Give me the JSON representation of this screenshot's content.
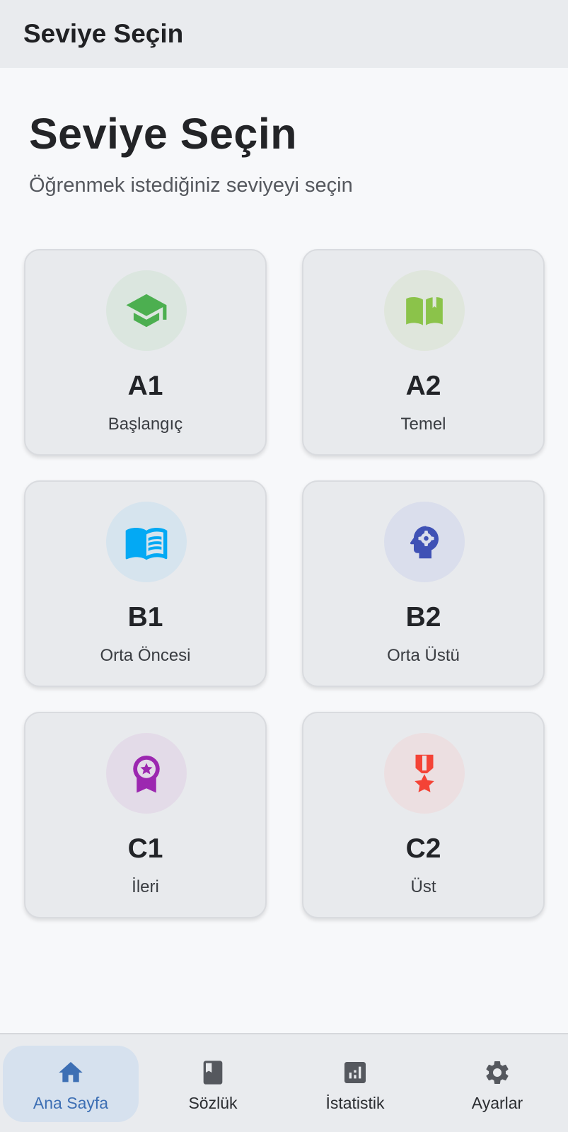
{
  "app_bar": {
    "title": "Seviye Seçin"
  },
  "main": {
    "title": "Seviye Seçin",
    "subtitle": "Öğrenmek istediğiniz seviyeyi seçin"
  },
  "levels": [
    {
      "code": "A1",
      "name": "Başlangıç",
      "icon": "graduation-cap-icon",
      "color": "#4caf50",
      "circle": "#dbe6df"
    },
    {
      "code": "A2",
      "name": "Temel",
      "icon": "open-book-icon",
      "color": "#8bc34a",
      "circle": "#dfe6dc"
    },
    {
      "code": "B1",
      "name": "Orta Öncesi",
      "icon": "reading-book-icon",
      "color": "#03a9f4",
      "circle": "#d6e4ee"
    },
    {
      "code": "B2",
      "name": "Orta Üstü",
      "icon": "psychology-head-icon",
      "color": "#3f51b5",
      "circle": "#dadeec"
    },
    {
      "code": "C1",
      "name": "İleri",
      "icon": "award-badge-icon",
      "color": "#9c27b0",
      "circle": "#e3dbe8"
    },
    {
      "code": "C2",
      "name": "Üst",
      "icon": "military-medal-icon",
      "color": "#f44336",
      "circle": "#ecdfe1"
    }
  ],
  "bottom_nav": {
    "items": [
      {
        "label": "Ana Sayfa",
        "icon": "home-icon",
        "active": true
      },
      {
        "label": "Sözlük",
        "icon": "bookmark-book-icon",
        "active": false
      },
      {
        "label": "İstatistik",
        "icon": "bar-chart-icon",
        "active": false
      },
      {
        "label": "Ayarlar",
        "icon": "gear-icon",
        "active": false
      }
    ],
    "active_color": "#3d6fb4",
    "inactive_color": "#55585e"
  }
}
